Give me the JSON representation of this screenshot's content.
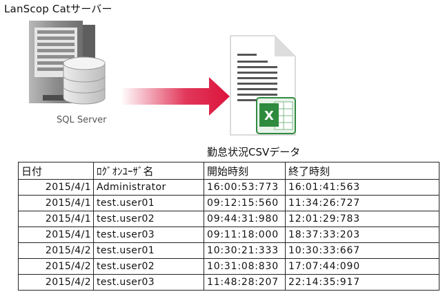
{
  "server_title": "LanScop Catサーバー",
  "sql_label": "SQL Server",
  "csv_label": "勤怠状況CSVデータ",
  "excel_icon_letter": "X",
  "colors": {
    "arrow": "#dc143c",
    "excel_green": "#2e8b3e",
    "server_gray": "#8a8a8a"
  },
  "table": {
    "headers": [
      "日付",
      "ﾛｸﾞｵﾝﾕｰｻﾞ名",
      "開始時刻",
      "終了時刻"
    ],
    "rows": [
      [
        "2015/4/1",
        "Administrator",
        "16:00:53:773",
        "16:01:41:563"
      ],
      [
        "2015/4/1",
        "test.user01",
        "09:12:15:560",
        "11:34:26:727"
      ],
      [
        "2015/4/1",
        "test.user02",
        "09:44:31:980",
        "12:01:29:783"
      ],
      [
        "2015/4/1",
        "test.user03",
        "09:11:18:000",
        "18:37:33:203"
      ],
      [
        "2015/4/2",
        "test.user01",
        "10:30:21:333",
        "10:30:33:667"
      ],
      [
        "2015/4/2",
        "test.user02",
        "10:31:08:830",
        "17:07:44:090"
      ],
      [
        "2015/4/2",
        "test.user03",
        "11:48:28:207",
        "22:14:35:917"
      ]
    ]
  }
}
